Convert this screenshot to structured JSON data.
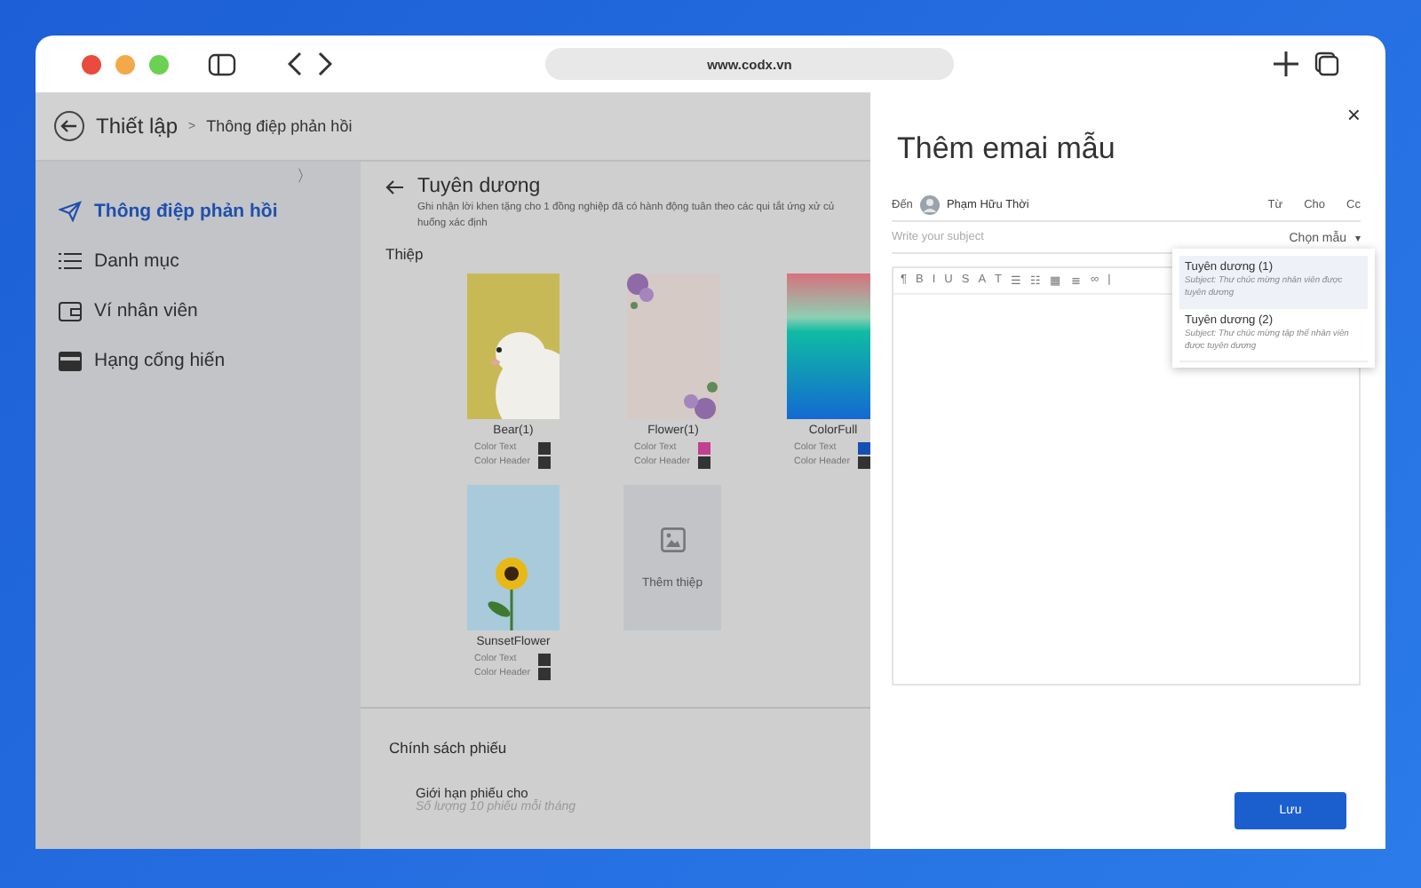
{
  "browser": {
    "url": "www.codx.vn"
  },
  "header": {
    "title": "Thiết lập",
    "breadcrumb_separator": ">",
    "breadcrumb": "Thông điệp phản hồi"
  },
  "sidebar": {
    "toggle": "〉",
    "items": [
      {
        "label": "Thông điệp phản hồi",
        "kind": "send",
        "selected": true
      },
      {
        "label": "Danh mục",
        "kind": "list",
        "selected": false
      },
      {
        "label": "Ví nhân viên",
        "kind": "wallet",
        "selected": false
      },
      {
        "label": "Hạng cống hiến",
        "kind": "card",
        "selected": false
      }
    ]
  },
  "content": {
    "title": "Tuyên dương",
    "description": [
      "Ghi nhận lời khen tặng cho 1 đồng nghiệp đã có hành động tuân theo các qui tắt ứng xử củ",
      "huống xác định"
    ],
    "section": "Thiệp",
    "cards": [
      {
        "kind": "bear",
        "name": "Bear(1)",
        "swatches": [
          {
            "label": "Color Text",
            "color": "#333333"
          },
          {
            "label": "Color Header",
            "color": "#333333"
          }
        ]
      },
      {
        "kind": "flower",
        "name": "Flower(1)",
        "swatches": [
          {
            "label": "Color Text",
            "color": "#c2408f"
          },
          {
            "label": "Color Header",
            "color": "#333333"
          }
        ]
      },
      {
        "kind": "gradient",
        "name": "ColorFull",
        "swatches": [
          {
            "label": "Color Text",
            "color": "#1450b4"
          },
          {
            "label": "Color Header",
            "color": "#333333"
          }
        ]
      },
      {
        "kind": "sunflower",
        "name": "SunsetFlower",
        "swatches": [
          {
            "label": "Color Text",
            "color": "#333333"
          },
          {
            "label": "Color Header",
            "color": "#333333"
          }
        ]
      }
    ],
    "add_card": "Thêm thiệp",
    "policy": {
      "title": "Chính sách phiếu",
      "item": "Giới hạn phiếu cho",
      "note": "Số lượng 10 phiếu mỗi tháng"
    }
  },
  "drawer": {
    "title": "Thêm emai mẫu",
    "close": "×",
    "to_label": "Đến",
    "recipient": "Phạm Hữu Thời",
    "fields": [
      "Từ",
      "Cho",
      "Cc"
    ],
    "subject_placeholder": "Write your subject",
    "template_picker": "Chọn mẫu",
    "caret": "▾",
    "toolbar": [
      "¶",
      "B",
      "I",
      "U",
      "S",
      "A",
      "T",
      "☰",
      "☷",
      "▦",
      "≣",
      "∞",
      "|"
    ],
    "templates": [
      {
        "title": "Tuyên dương (1)",
        "subject": "Subject: Thư chúc mừng nhân viên được tuyên dương",
        "selected": true
      },
      {
        "title": "Tuyên dương (2)",
        "subject": "Subject: Thư chúc mừng tập thể nhân viên được tuyên dương",
        "selected": false
      }
    ],
    "save": "Lưu"
  }
}
